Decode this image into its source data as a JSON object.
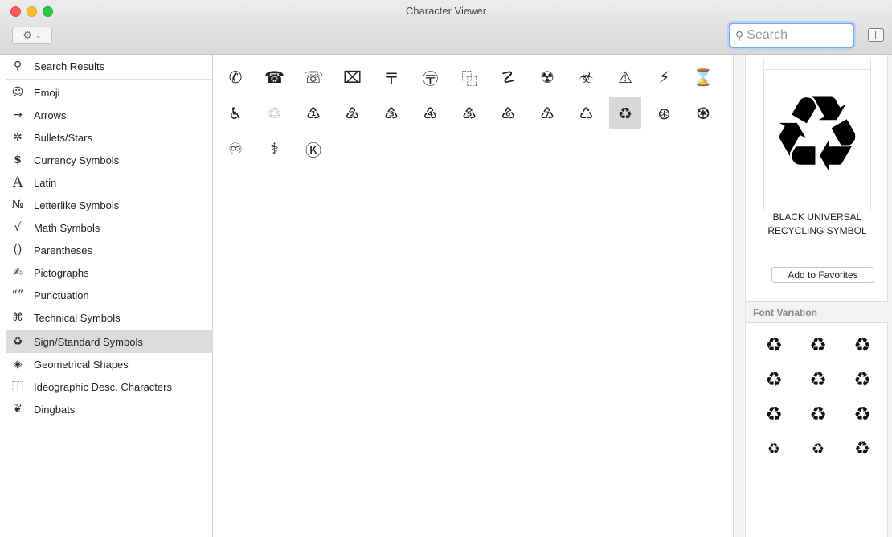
{
  "window": {
    "title": "Character Viewer"
  },
  "toolbar": {
    "gear_icon": "⚙",
    "chevron": "⌄",
    "search_placeholder": "Search",
    "search_icon": "⚲"
  },
  "sidebar": {
    "items": [
      {
        "icon": "⚲",
        "label": "Search Results"
      },
      {
        "icon": "☺",
        "label": "Emoji"
      },
      {
        "icon": "→",
        "label": "Arrows"
      },
      {
        "icon": "✲",
        "label": "Bullets/Stars"
      },
      {
        "icon": "$",
        "label": "Currency Symbols"
      },
      {
        "icon": "A",
        "label": "Latin"
      },
      {
        "icon": "№",
        "label": "Letterlike Symbols"
      },
      {
        "icon": "√",
        "label": "Math Symbols"
      },
      {
        "icon": "()",
        "label": "Parentheses"
      },
      {
        "icon": "✍",
        "label": "Pictographs"
      },
      {
        "icon": "“”",
        "label": "Punctuation"
      },
      {
        "icon": "⌘",
        "label": "Technical Symbols"
      },
      {
        "icon": "♻",
        "label": "Sign/Standard Symbols"
      },
      {
        "icon": "◈",
        "label": "Geometrical Shapes"
      },
      {
        "icon": "⿰",
        "label": "Ideographic Desc. Characters"
      },
      {
        "icon": "❦",
        "label": "Dingbats"
      }
    ],
    "selected_index": 12
  },
  "grid": {
    "rows": [
      [
        "✆",
        "☎",
        "☏",
        "⌧",
        "〒",
        "〶",
        "⿻",
        "☡",
        "☢",
        "☣",
        "⚠",
        "⚡",
        "⌛"
      ],
      [
        "♿",
        "♲",
        "♳",
        "♴",
        "♵",
        "♶",
        "♷",
        "♸",
        "♹",
        "♺",
        "♻",
        "⊛",
        "♼"
      ],
      [
        "♾",
        "⚕",
        "Ⓚ"
      ]
    ],
    "selected": {
      "row": 1,
      "col": 10
    },
    "light": [
      {
        "row": 1,
        "col": 1
      }
    ]
  },
  "inspector": {
    "preview_glyph": "♻",
    "char_name": "BLACK UNIVERSAL RECYCLING SYMBOL",
    "add_to_favorites": "Add to Favorites",
    "font_variation_label": "Font Variation",
    "font_variations": [
      "♻",
      "♻",
      "♻",
      "♻",
      "♻",
      "♻",
      "♻",
      "♻",
      "♻",
      "♻",
      "♻",
      "♻"
    ]
  }
}
